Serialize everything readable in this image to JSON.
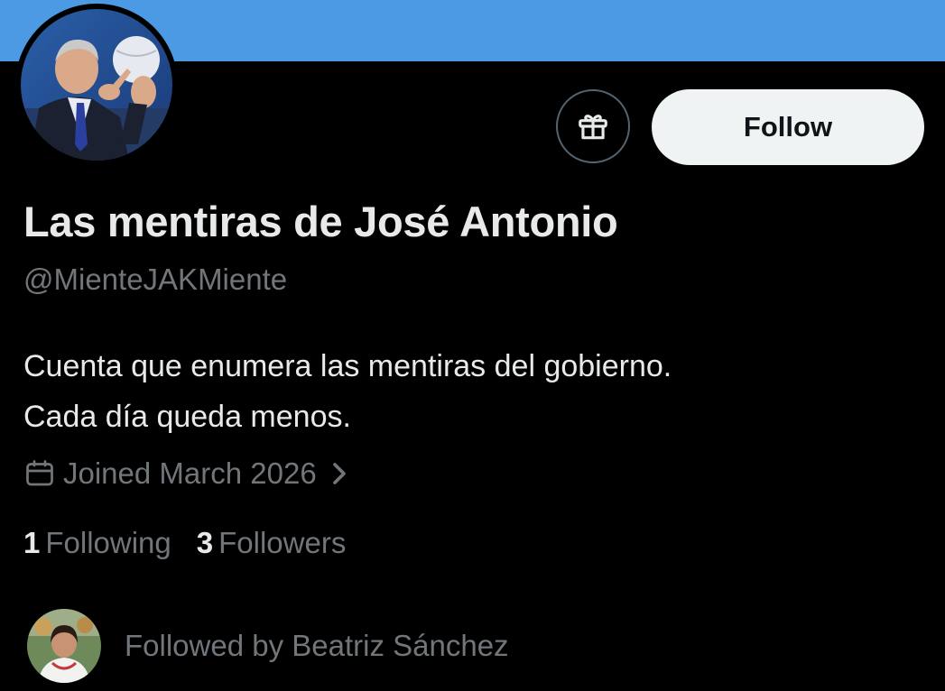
{
  "colors": {
    "banner": "#4c9ae4",
    "background": "#000000",
    "primary_text": "#e7e9ea",
    "secondary_text": "#71767b",
    "follow_button_bg": "#eff3f4",
    "follow_button_text": "#0f1419"
  },
  "profile": {
    "display_name": "Las mentiras de José Antonio",
    "handle": "@MienteJAKMiente",
    "bio_lines": [
      "Cuenta que enumera las mentiras del gobierno.",
      "Cada día queda menos."
    ],
    "joined": "Joined March 2026",
    "avatar_icon": "profile-photo"
  },
  "actions": {
    "gift_icon": "gift-icon",
    "follow_label": "Follow"
  },
  "stats": {
    "following_count": "1",
    "following_label": "Following",
    "followers_count": "3",
    "followers_label": "Followers"
  },
  "followed_by": {
    "text": "Followed by Beatriz Sánchez"
  }
}
